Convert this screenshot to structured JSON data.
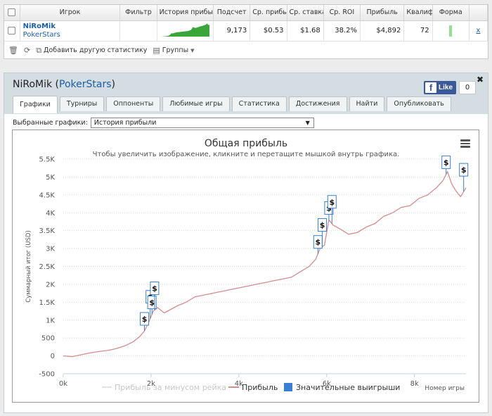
{
  "stats_table": {
    "headers": [
      "Игрок",
      "Фильтр",
      "История прибыли",
      "Подсчет",
      "Ср. прибыль",
      "Ср. ставка",
      "Ср. ROI",
      "Прибыль",
      "Квалиф",
      "Форма"
    ],
    "row": {
      "player": "NiRoMik",
      "room": "PokerStars",
      "filter": "",
      "count": "9,173",
      "avg_profit": "$0.53",
      "avg_stake": "$1.68",
      "avg_roi": "38.2%",
      "profit": "$4,892",
      "qualified": "72",
      "remove": "x"
    },
    "toolbar": {
      "add_stat": "Добавить другую статистику",
      "groups": "Группы"
    }
  },
  "player_panel": {
    "name": "NiRoMik",
    "room": "PokerStars",
    "like_label": "Like",
    "like_count": "0",
    "close": "✖",
    "tabs": [
      "Графики",
      "Турниры",
      "Оппоненты",
      "Любимые игры",
      "Статистика",
      "Достижения",
      "Найти",
      "Опубликовать"
    ],
    "active_tab": 0,
    "select_label": "Выбранные графики:",
    "select_value": "История прибыли"
  },
  "icons": {
    "trash": "trash-icon",
    "refresh": "refresh-icon",
    "add": "add-stat-icon",
    "groups": "groups-icon",
    "menu": "menu-icon",
    "dollar": "dollar-marker-icon"
  },
  "colors": {
    "profit_line": "#d88b8b",
    "rake_line": "#e3e3e3",
    "wins_marker": "#3a7fd0",
    "sparkline": "#3aa63a"
  },
  "chart_data": {
    "type": "line",
    "title": "Общая прибыль",
    "subtitle": "Чтобы увеличить изображение, кликните и перетащите мышкой внутрь графика.",
    "ylabel": "Суммарный итог (USD)",
    "xlabel": "Номер игры",
    "xlim": [
      0,
      9173
    ],
    "ylim": [
      -500,
      5500
    ],
    "y_ticks": [
      -500,
      0,
      500,
      1000,
      1500,
      2000,
      2500,
      3000,
      3500,
      4000,
      4500,
      5000,
      5500
    ],
    "y_tick_labels": [
      "-500",
      "0",
      "500",
      "1K",
      "1.5K",
      "2K",
      "2.5K",
      "3K",
      "3.5K",
      "4K",
      "4.5K",
      "5K",
      "5.5K"
    ],
    "x_ticks": [
      0,
      2000,
      4000,
      6000,
      8000
    ],
    "x_tick_labels": [
      "0k",
      "2k",
      "4k",
      "6k",
      "8k"
    ],
    "grid": true,
    "legend": "bottom",
    "legend_entries": [
      "Прибыль за минусом рейка",
      "Прибыль",
      "Значительные выигрыши"
    ],
    "series": [
      {
        "name": "Прибыль",
        "x": [
          0,
          200,
          400,
          600,
          800,
          1000,
          1200,
          1400,
          1600,
          1750,
          1850,
          1950,
          2050,
          2150,
          2300,
          2450,
          2600,
          2800,
          3000,
          3200,
          3400,
          3600,
          3800,
          4000,
          4200,
          4400,
          4600,
          4800,
          5000,
          5200,
          5400,
          5600,
          5750,
          5850,
          5950,
          6050,
          6150,
          6300,
          6500,
          6700,
          6900,
          7100,
          7300,
          7500,
          7700,
          7900,
          8100,
          8300,
          8500,
          8650,
          8750,
          8850,
          8950,
          9050,
          9173
        ],
        "y": [
          0,
          -20,
          30,
          80,
          120,
          150,
          200,
          280,
          400,
          550,
          700,
          950,
          1250,
          1350,
          1200,
          1300,
          1400,
          1500,
          1650,
          1700,
          1750,
          1800,
          1850,
          1900,
          1950,
          2000,
          2050,
          2100,
          2150,
          2200,
          2350,
          2500,
          2700,
          3000,
          3100,
          3800,
          3650,
          3550,
          3400,
          3450,
          3600,
          3700,
          3900,
          4000,
          4150,
          4200,
          4400,
          4500,
          4700,
          4900,
          5150,
          4800,
          4600,
          4450,
          4700
        ]
      }
    ],
    "significant_wins_x": [
      1850,
      1980,
      2020,
      2080,
      5800,
      5900,
      6050,
      6120,
      8720,
      9120
    ]
  }
}
